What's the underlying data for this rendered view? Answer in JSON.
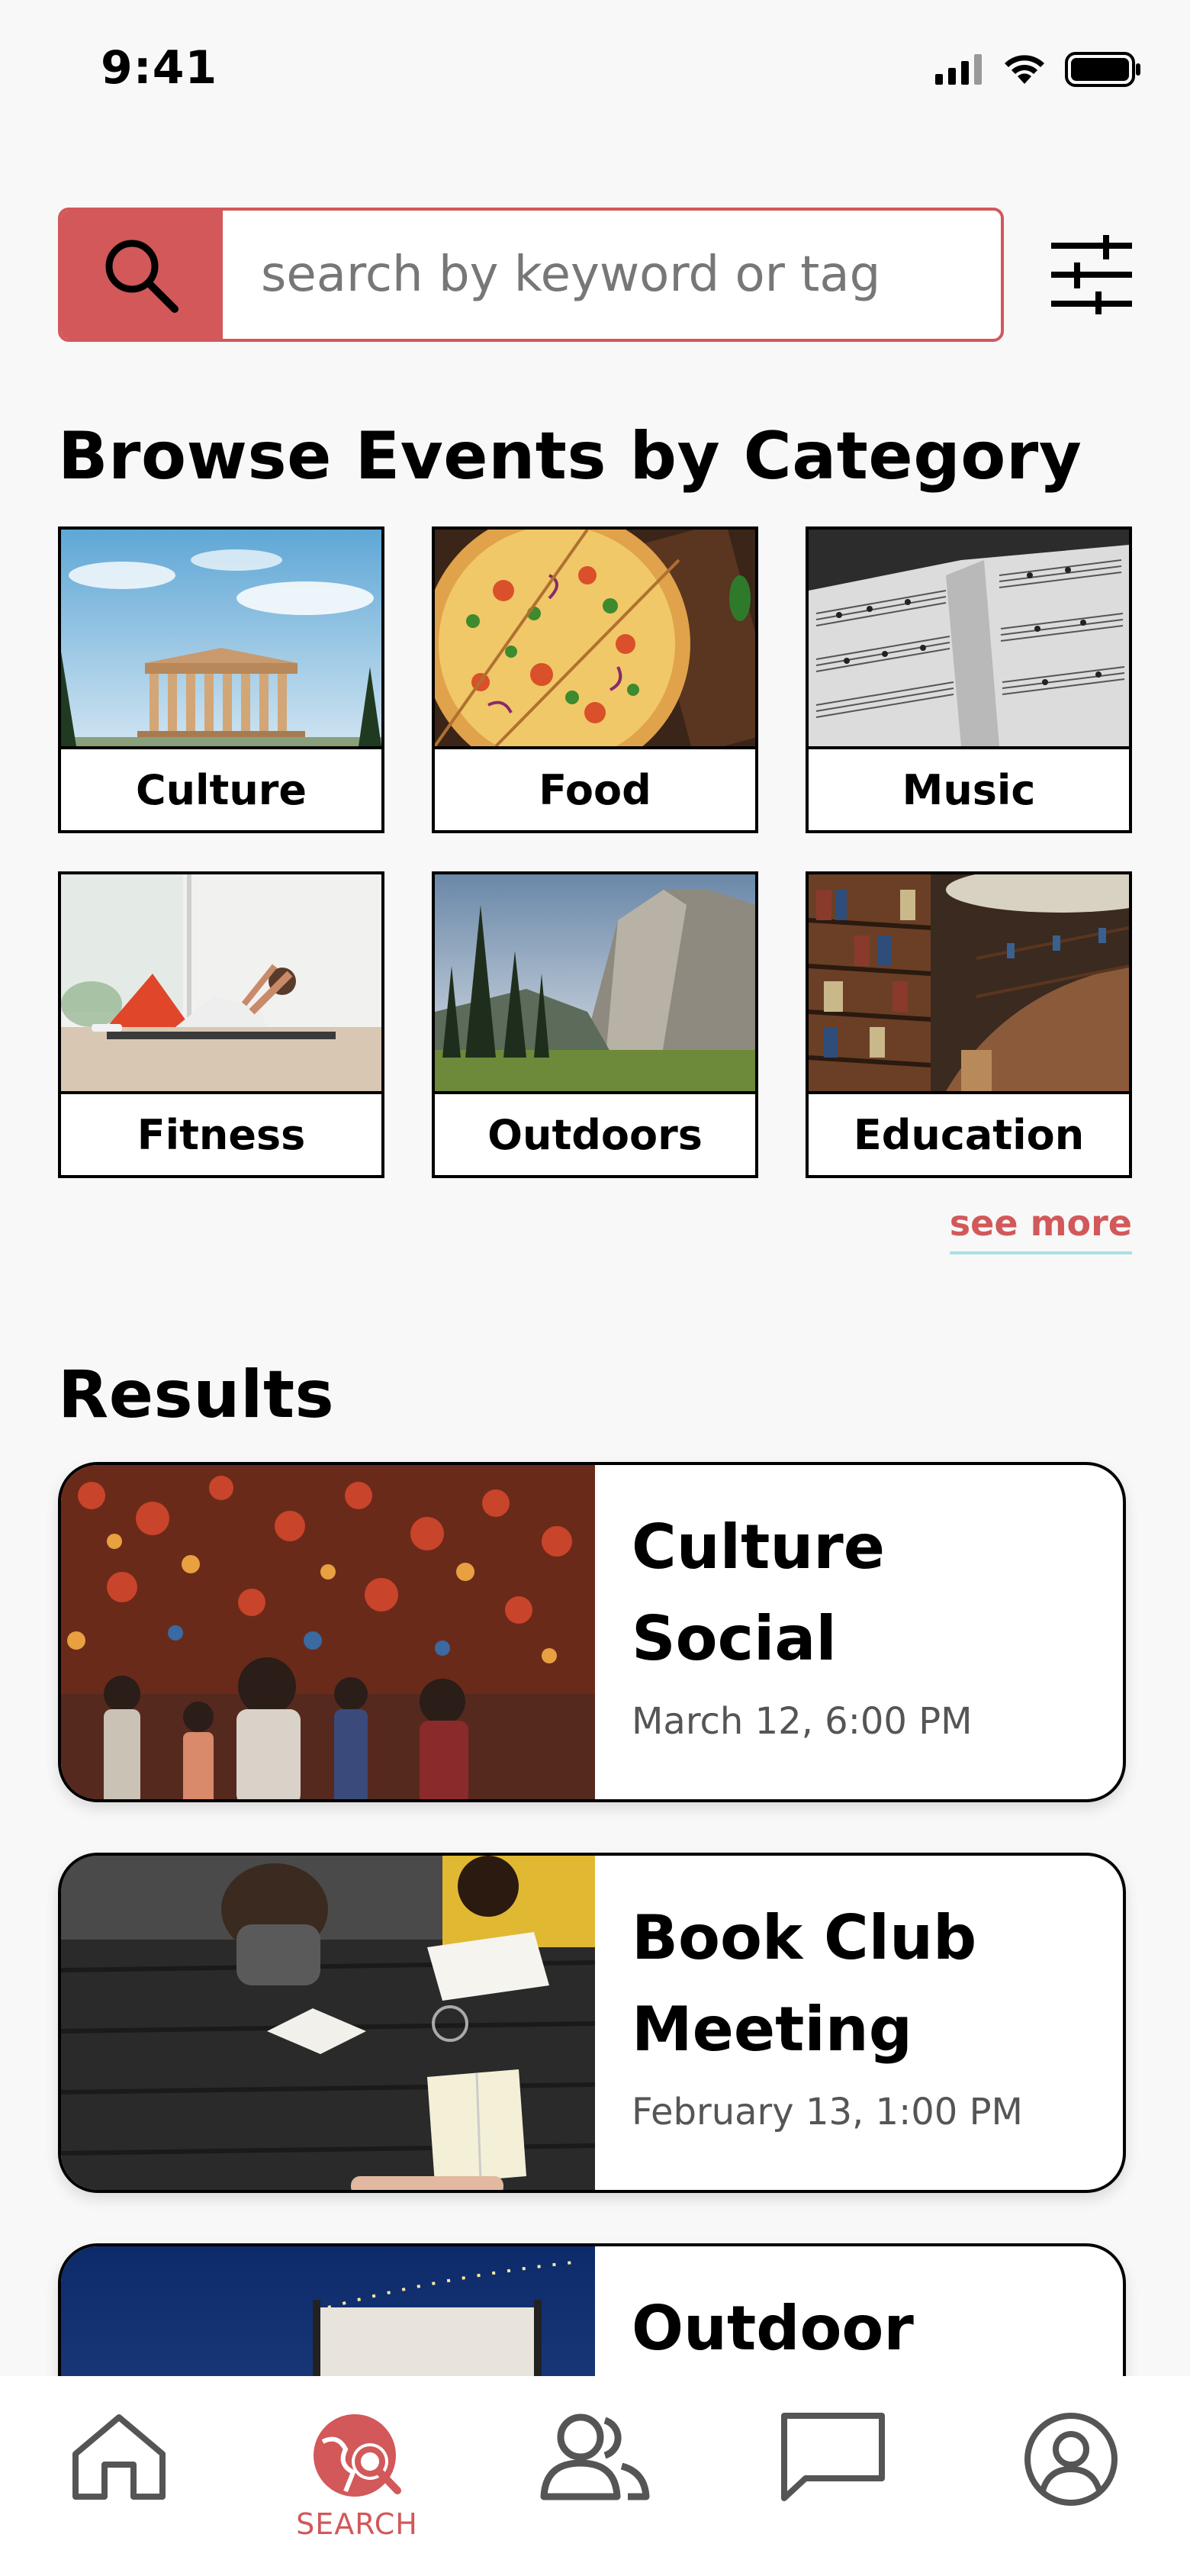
{
  "status": {
    "time": "9:41"
  },
  "search": {
    "placeholder": "search by keyword or tag"
  },
  "browse": {
    "title": "Browse Events by Category",
    "categories": [
      {
        "label": "Culture"
      },
      {
        "label": "Food"
      },
      {
        "label": "Music"
      },
      {
        "label": "Fitness"
      },
      {
        "label": "Outdoors"
      },
      {
        "label": "Education"
      }
    ],
    "see_more": "see more"
  },
  "results": {
    "title": "Results",
    "items": [
      {
        "title": "Culture Social",
        "date": "March 12, 6:00 PM"
      },
      {
        "title": "Book Club Meeting",
        "date": "February 13, 1:00 PM"
      },
      {
        "title": "Outdoor",
        "date": ""
      }
    ]
  },
  "nav": {
    "items": [
      {
        "name": "home",
        "icon": "home-icon"
      },
      {
        "name": "search",
        "icon": "globe-search-icon",
        "label": "SEARCH",
        "active": true
      },
      {
        "name": "people",
        "icon": "people-icon"
      },
      {
        "name": "messages",
        "icon": "chat-icon"
      },
      {
        "name": "profile",
        "icon": "user-circle-icon"
      }
    ]
  },
  "colors": {
    "accent": "#d2585a",
    "underline": "#a9dfe5"
  }
}
